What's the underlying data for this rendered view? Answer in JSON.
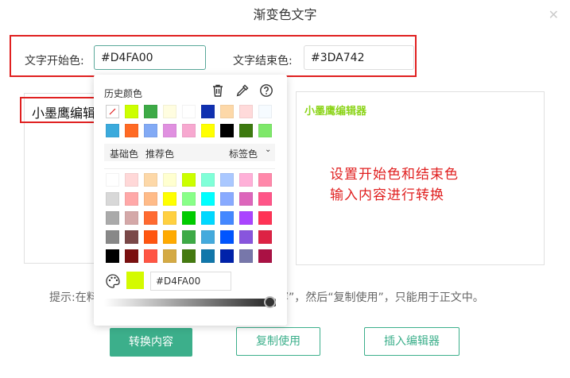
{
  "dialog": {
    "title": "渐变色文字"
  },
  "start": {
    "label": "文字开始色:",
    "value": "#D4FA00"
  },
  "end": {
    "label": "文字结束色:",
    "value": "#3DA742"
  },
  "editor": {
    "text": "小墨鹰编辑"
  },
  "preview": {
    "text": "小墨鹰编辑器",
    "color": "#8cd41a"
  },
  "annotation": {
    "line1": "设置开始色和结束色",
    "line2": "输入内容进行转换"
  },
  "hint": {
    "left": "提示:在料",
    "right": "内容”，然后“复制使用”，只能用于正文中。"
  },
  "buttons": {
    "convert": "转换内容",
    "copy": "复制使用",
    "insert": "插入编辑器"
  },
  "picker": {
    "history_label": "历史颜色",
    "history_colors": [
      [
        "none",
        "#ccff00",
        "#3daa46",
        "#fffde0",
        "#ffffff",
        "#1030b0",
        "#fdd8a8",
        "#ffdada",
        "#f6fbff"
      ],
      [
        "#3baadc",
        "#ff6a24",
        "#82aaf5",
        "#e090e0",
        "#f7a8d0",
        "#ffff00",
        "#000000",
        "#3d7a10",
        "#7ee86a"
      ]
    ],
    "tabs": {
      "basic": "基础色",
      "recommended": "推荐色",
      "tag": "标签色"
    },
    "grid_colors": [
      [
        "#ffffff",
        "#ffd8d8",
        "#fdd8a8",
        "#ffffd0",
        "#ccff00",
        "#80ffd8",
        "#aac8ff",
        "#ffb0d8",
        "#ff88aa"
      ],
      [
        "#d8d8d8",
        "#ffa8a8",
        "#ffbb88",
        "#ffff00",
        "#88ff88",
        "#00ffff",
        "#88aaff",
        "#dd66bb",
        "#ff5588"
      ],
      [
        "#aaaaaa",
        "#d4a8a8",
        "#ff6a30",
        "#ffd040",
        "#00cc00",
        "#00d8ff",
        "#4488ff",
        "#aa44ff",
        "#ff3355"
      ],
      [
        "#888888",
        "#7a4848",
        "#ff5510",
        "#ffaa00",
        "#3daa46",
        "#44aadd",
        "#0055ff",
        "#8855dd",
        "#dd2244"
      ],
      [
        "#000000",
        "#7a1010",
        "#ff5544",
        "#d4aa44",
        "#447a10",
        "#1177aa",
        "#0022aa",
        "#7777aa",
        "#aa1144"
      ]
    ],
    "current_hex": "#D4FA00"
  }
}
